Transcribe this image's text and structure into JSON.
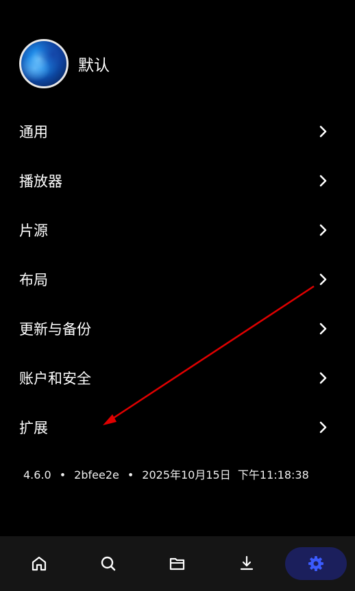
{
  "profile": {
    "name": "默认"
  },
  "menu": {
    "items": [
      {
        "label": "通用"
      },
      {
        "label": "播放器"
      },
      {
        "label": "片源"
      },
      {
        "label": "布局"
      },
      {
        "label": "更新与备份"
      },
      {
        "label": "账户和安全"
      },
      {
        "label": "扩展"
      }
    ]
  },
  "version": {
    "number": "4.6.0",
    "commit": "2bfee2e",
    "datetime": "2025年10月15日  下午11:18:38"
  },
  "bottom_nav": {
    "items": [
      {
        "icon": "home-icon"
      },
      {
        "icon": "search-icon"
      },
      {
        "icon": "folder-icon"
      },
      {
        "icon": "download-icon"
      },
      {
        "icon": "settings-gear-icon",
        "active": true
      }
    ],
    "active_color": "#3b5bfd"
  },
  "annotation": {
    "arrow_color": "#e00000"
  }
}
